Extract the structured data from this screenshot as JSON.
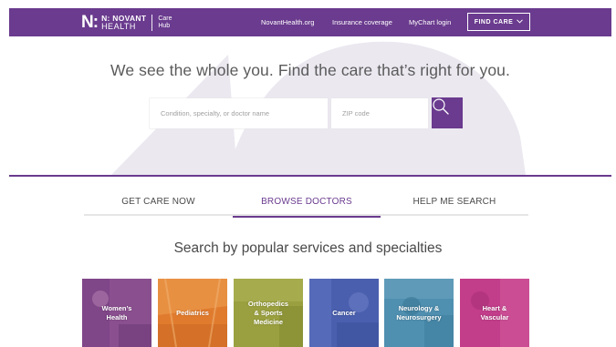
{
  "header": {
    "brand_primary": "N: NOVANT",
    "brand_secondary": "HEALTH",
    "brand_sub_line1": "Care",
    "brand_sub_line2": "Hub",
    "nav_links": [
      "NovantHealth.org",
      "Insurance coverage",
      "MyChart login"
    ],
    "find_care_label": "FIND CARE",
    "find_care_icon": "chevron-down-icon"
  },
  "hero": {
    "title": "We see the whole you. Find the care that’s right for you.",
    "condition_placeholder": "Condition, specialty, or doctor name",
    "zip_placeholder": "ZIP code",
    "search_icon": "search-icon"
  },
  "tabs": {
    "items": [
      "GET CARE NOW",
      "BROWSE DOCTORS",
      "HELP ME SEARCH"
    ],
    "active": "BROWSE DOCTORS"
  },
  "specialties": {
    "title": "Search by popular services and specialties",
    "tiles": [
      {
        "label": "Women’s\nHealth",
        "color": "#8a4f8f"
      },
      {
        "label": "Pediatrics",
        "color": "#e07b2e"
      },
      {
        "label": "Orthopedics\n& Sports\nMedicine",
        "color": "#9aa03f"
      },
      {
        "label": "Cancer",
        "color": "#4a5fae"
      },
      {
        "label": "Neurology &\nNeurosurgery",
        "color": "#4f8fb0"
      },
      {
        "label": "Heart &\nVascular",
        "color": "#c23d8a"
      }
    ]
  },
  "colors": {
    "brand_purple": "#6a3b8e",
    "hero_shape": "#ebe8f0",
    "tab_border": "#e6e6e6"
  }
}
